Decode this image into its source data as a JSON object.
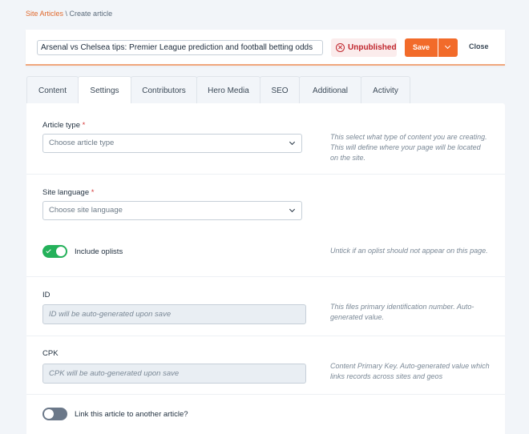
{
  "breadcrumb": {
    "link": "Site Articles",
    "separator": " \\ ",
    "current": "Create article"
  },
  "header": {
    "title_value": "Arsenal vs Chelsea tips: Premier League prediction and football betting odds",
    "status": "Unpublished",
    "save_label": "Save",
    "close_label": "Close",
    "icons": {
      "status": "x-circle-icon",
      "dropdown": "chevron-down-icon"
    }
  },
  "tabs": [
    {
      "label": "Content",
      "active": false
    },
    {
      "label": "Settings",
      "active": true
    },
    {
      "label": "Contributors",
      "active": false
    },
    {
      "label": "Hero Media",
      "active": false
    },
    {
      "label": "SEO",
      "active": false
    },
    {
      "label": "Additional",
      "active": false
    },
    {
      "label": "Activity",
      "active": false
    }
  ],
  "settings": {
    "article_type": {
      "label": "Article type",
      "required_mark": "*",
      "placeholder": "Choose article type",
      "help": "This select what type of content you are creating. This will define where your page will be located on the site."
    },
    "site_language": {
      "label": "Site language",
      "required_mark": "*",
      "placeholder": "Choose site language"
    },
    "include_oplists": {
      "label": "Include oplists",
      "enabled": true,
      "help": "Untick if an oplist should not appear on this page."
    },
    "id": {
      "label": "ID",
      "placeholder": "ID will be auto-generated upon save",
      "help": "This files primary identification number. Auto-generated value."
    },
    "cpk": {
      "label": "CPK",
      "placeholder": "CPK will be auto-generated upon save",
      "help": "Content Primary Key. Auto-generated value which links records across sites and geos"
    },
    "link_article": {
      "label": "Link this article to another article?",
      "enabled": false
    }
  },
  "colors": {
    "accent": "#f26b2a",
    "toggle_on": "#24b15a",
    "status_red": "#c0262d"
  }
}
